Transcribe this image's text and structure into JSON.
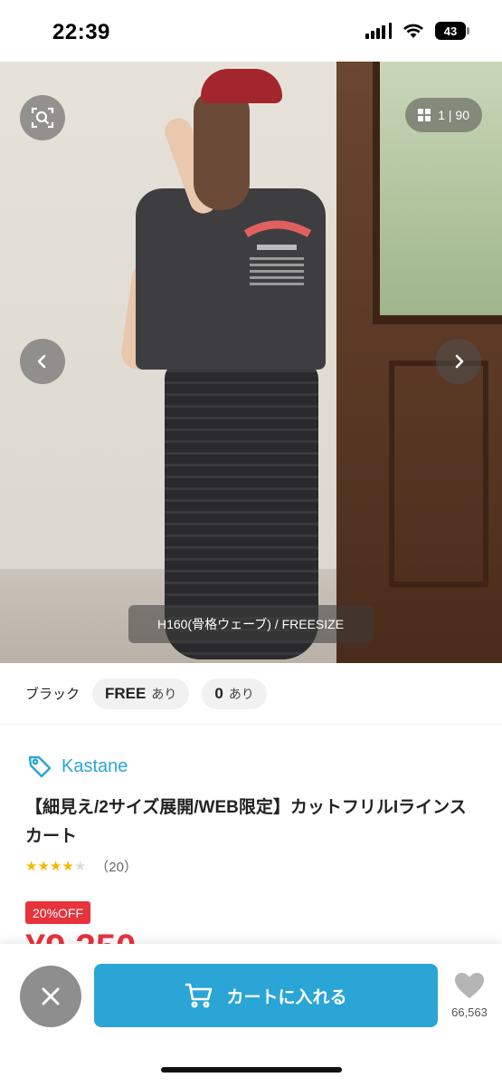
{
  "status_bar": {
    "time": "22:39",
    "battery": "43"
  },
  "hero": {
    "counter": "1 | 90",
    "caption": "H160(骨格ウェーブ) / FREESIZE"
  },
  "variant": {
    "color": "ブラック",
    "options": [
      {
        "size": "FREE",
        "stock": "あり"
      },
      {
        "size": "0",
        "stock": "あり"
      }
    ]
  },
  "product": {
    "brand": "Kastane",
    "title": "【細見え/2サイズ展開/WEB限定】カットフリルIラインスカート",
    "rating_stars": 4,
    "rating_count": "（20）",
    "discount": "20%OFF",
    "price": "¥9,350"
  },
  "bottom_bar": {
    "cart_label": "カートに入れる",
    "favorite_count": "66,563"
  },
  "colors": {
    "accent": "#2ba5d6",
    "sale": "#e8323c",
    "star": "#f5b800"
  }
}
